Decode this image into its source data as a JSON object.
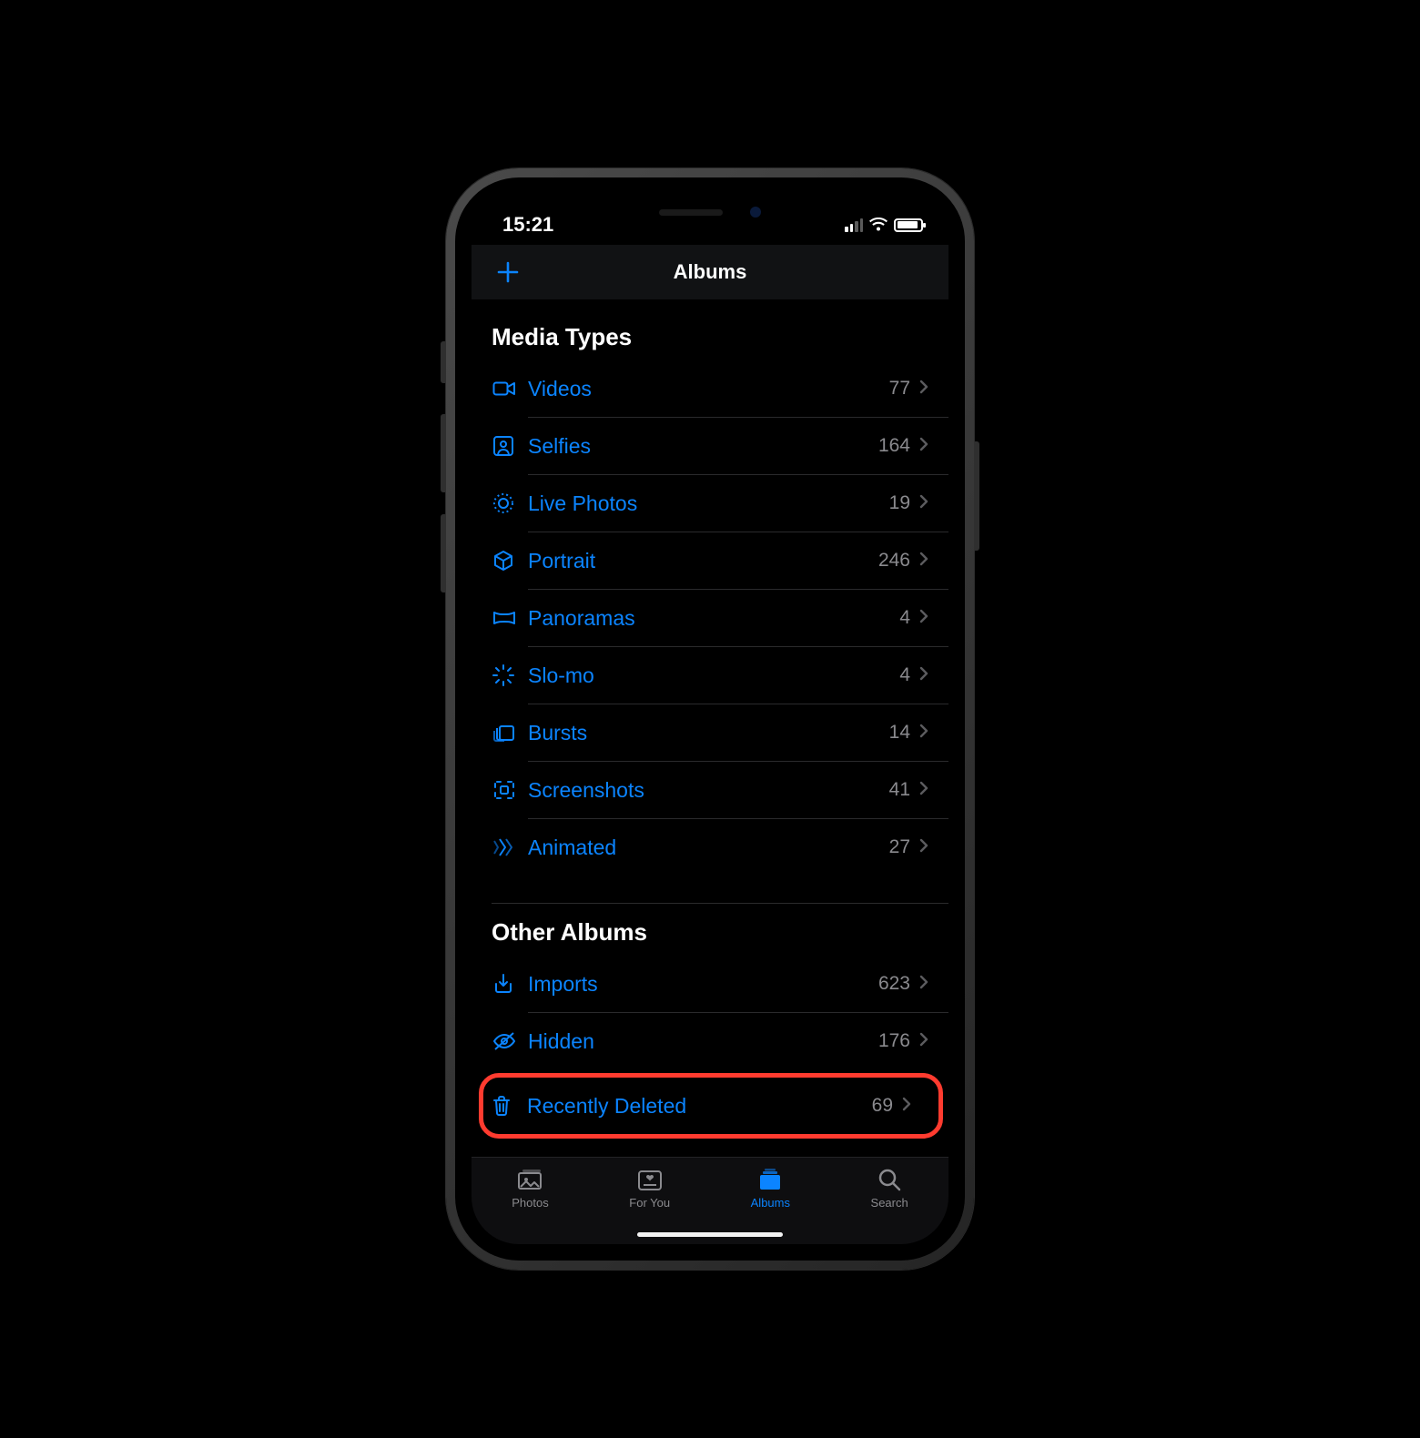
{
  "statusbar": {
    "time": "15:21"
  },
  "navbar": {
    "title": "Albums",
    "add_label": "Add"
  },
  "sections": {
    "media_types": {
      "title": "Media Types",
      "items": [
        {
          "icon": "videocam-icon",
          "label": "Videos",
          "count": "77"
        },
        {
          "icon": "selfie-icon",
          "label": "Selfies",
          "count": "164"
        },
        {
          "icon": "livephoto-icon",
          "label": "Live Photos",
          "count": "19"
        },
        {
          "icon": "cube-icon",
          "label": "Portrait",
          "count": "246"
        },
        {
          "icon": "panorama-icon",
          "label": "Panoramas",
          "count": "4"
        },
        {
          "icon": "slomo-icon",
          "label": "Slo-mo",
          "count": "4"
        },
        {
          "icon": "bursts-icon",
          "label": "Bursts",
          "count": "14"
        },
        {
          "icon": "screenshot-icon",
          "label": "Screenshots",
          "count": "41"
        },
        {
          "icon": "animated-icon",
          "label": "Animated",
          "count": "27"
        }
      ]
    },
    "other_albums": {
      "title": "Other Albums",
      "items": [
        {
          "icon": "import-icon",
          "label": "Imports",
          "count": "623"
        },
        {
          "icon": "hidden-icon",
          "label": "Hidden",
          "count": "176"
        },
        {
          "icon": "trash-icon",
          "label": "Recently Deleted",
          "count": "69",
          "highlighted": true
        }
      ]
    }
  },
  "tabs": [
    {
      "icon": "photos-icon",
      "label": "Photos",
      "active": false
    },
    {
      "icon": "foryou-icon",
      "label": "For You",
      "active": false
    },
    {
      "icon": "albums-icon",
      "label": "Albums",
      "active": true
    },
    {
      "icon": "search-icon",
      "label": "Search",
      "active": false
    }
  ]
}
